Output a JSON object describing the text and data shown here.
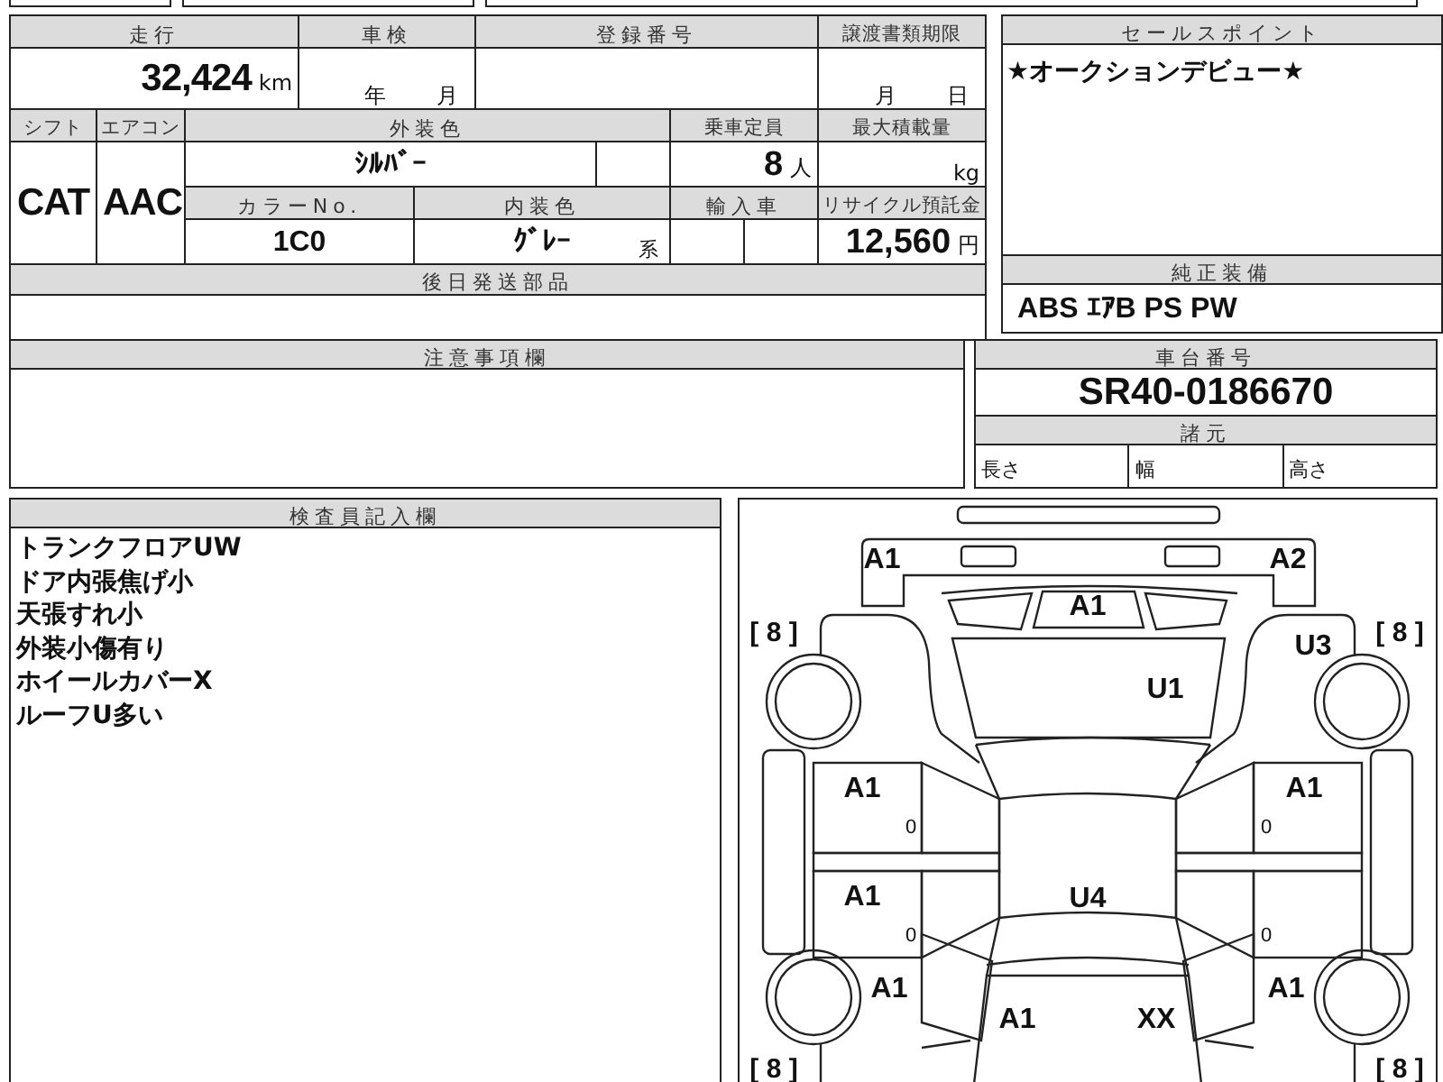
{
  "mileage": {
    "label": "走行",
    "value": "32,424",
    "unit": "km"
  },
  "inspection_expiry": {
    "label": "車検",
    "year_unit": "年",
    "month_unit": "月"
  },
  "registration_number": {
    "label": "登録番号"
  },
  "transfer_deadline": {
    "label": "譲渡書類期限",
    "month_unit": "月",
    "day_unit": "日"
  },
  "shift": {
    "label": "シフト",
    "value": "CAT"
  },
  "air_conditioner": {
    "label": "エアコン",
    "value": "AAC"
  },
  "exterior_color": {
    "label": "外装色",
    "value": "ｼﾙﾊﾞｰ"
  },
  "seating_capacity": {
    "label": "乗車定員",
    "value": "8",
    "unit": "人"
  },
  "max_load": {
    "label": "最大積載量",
    "unit": "kg"
  },
  "color_number": {
    "label": "カラーNo.",
    "value": "1C0"
  },
  "interior_color": {
    "label": "内装色",
    "value": "ｸﾞﾚｰ",
    "suffix": "系"
  },
  "imported": {
    "label": "輸入車"
  },
  "recycling_deposit": {
    "label": "リサイクル預託金",
    "value": "12,560",
    "unit": "円"
  },
  "later_parts": {
    "label": "後日発送部品"
  },
  "sale_points": {
    "label": "セールスポイント",
    "text": "★オークションデビュー★"
  },
  "standard_equipment": {
    "label": "純正装備",
    "text": "ABS ｴｱB PS PW"
  },
  "notes": {
    "label": "注意事項欄"
  },
  "chassis_number": {
    "label": "車台番号",
    "value": "SR40-0186670"
  },
  "specifications": {
    "label": "諸元",
    "fields": [
      "長さ",
      "幅",
      "高さ"
    ]
  },
  "inspector_comments": {
    "label": "検査員記入欄",
    "lines": [
      "トランクフロアUW",
      "ドア内張焦げ小",
      "天張すれ小",
      "外装小傷有り",
      "ホイールカバーX",
      "ルーフU多い"
    ]
  },
  "damage_map": {
    "panels": {
      "front_bumper_left": {
        "code": "A1"
      },
      "front_bumper_right": {
        "code": "A2"
      },
      "grille": {
        "code": "A1"
      },
      "hood": {
        "code": "U1"
      },
      "front_right_fender": {
        "code": "U3"
      },
      "front_left_door": {
        "code": "A1",
        "mark": "0"
      },
      "rear_left_door": {
        "code": "A1",
        "mark": "0"
      },
      "front_right_door": {
        "code": "A1",
        "mark": "0"
      },
      "rear_right_door": {
        "mark": "0"
      },
      "roof": {
        "code": "U4"
      },
      "rear_left_quarter": {
        "code": "A1"
      },
      "rear_right_quarter": {
        "code": "A1"
      },
      "trunk_left": {
        "code": "A1"
      },
      "trunk_right": {
        "code": "XX"
      }
    },
    "tread_readings": {
      "front_left": "[ 8 ]",
      "front_right": "[ 8 ]",
      "rear_left": "[ 8 ]",
      "rear_right": "[ 8 ]"
    }
  }
}
